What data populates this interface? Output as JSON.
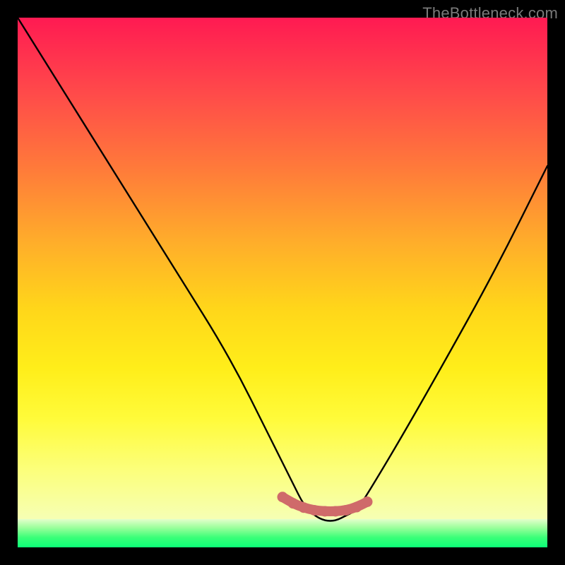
{
  "watermark": "TheBottleneck.com",
  "colors": {
    "background": "#000000",
    "curve_stroke": "#000000",
    "marker": "#cf6a6a",
    "gradient_top": "#ff1a52",
    "gradient_bottom": "#f6ffb4",
    "green_band": "#0cff78"
  },
  "chart_data": {
    "type": "line",
    "title": "",
    "xlabel": "",
    "ylabel": "",
    "xlim": [
      0,
      100
    ],
    "ylim": [
      0,
      100
    ],
    "grid": false,
    "legend": false,
    "series": [
      {
        "name": "bottleneck_curve",
        "x": [
          0,
          10,
          20,
          30,
          40,
          48,
          52,
          54,
          56,
          58,
          60,
          62,
          64,
          66,
          72,
          80,
          90,
          100
        ],
        "values": [
          100,
          84,
          68,
          52,
          36,
          20,
          12,
          8,
          6,
          5,
          5,
          6,
          7,
          10,
          20,
          34,
          52,
          72
        ]
      }
    ],
    "optimal_range_markers": {
      "x": [
        50,
        52,
        54,
        56,
        58,
        60,
        62,
        64,
        66
      ],
      "y": [
        9.5,
        8.3,
        7.5,
        7.0,
        6.8,
        6.8,
        7.0,
        7.6,
        8.6
      ]
    }
  }
}
